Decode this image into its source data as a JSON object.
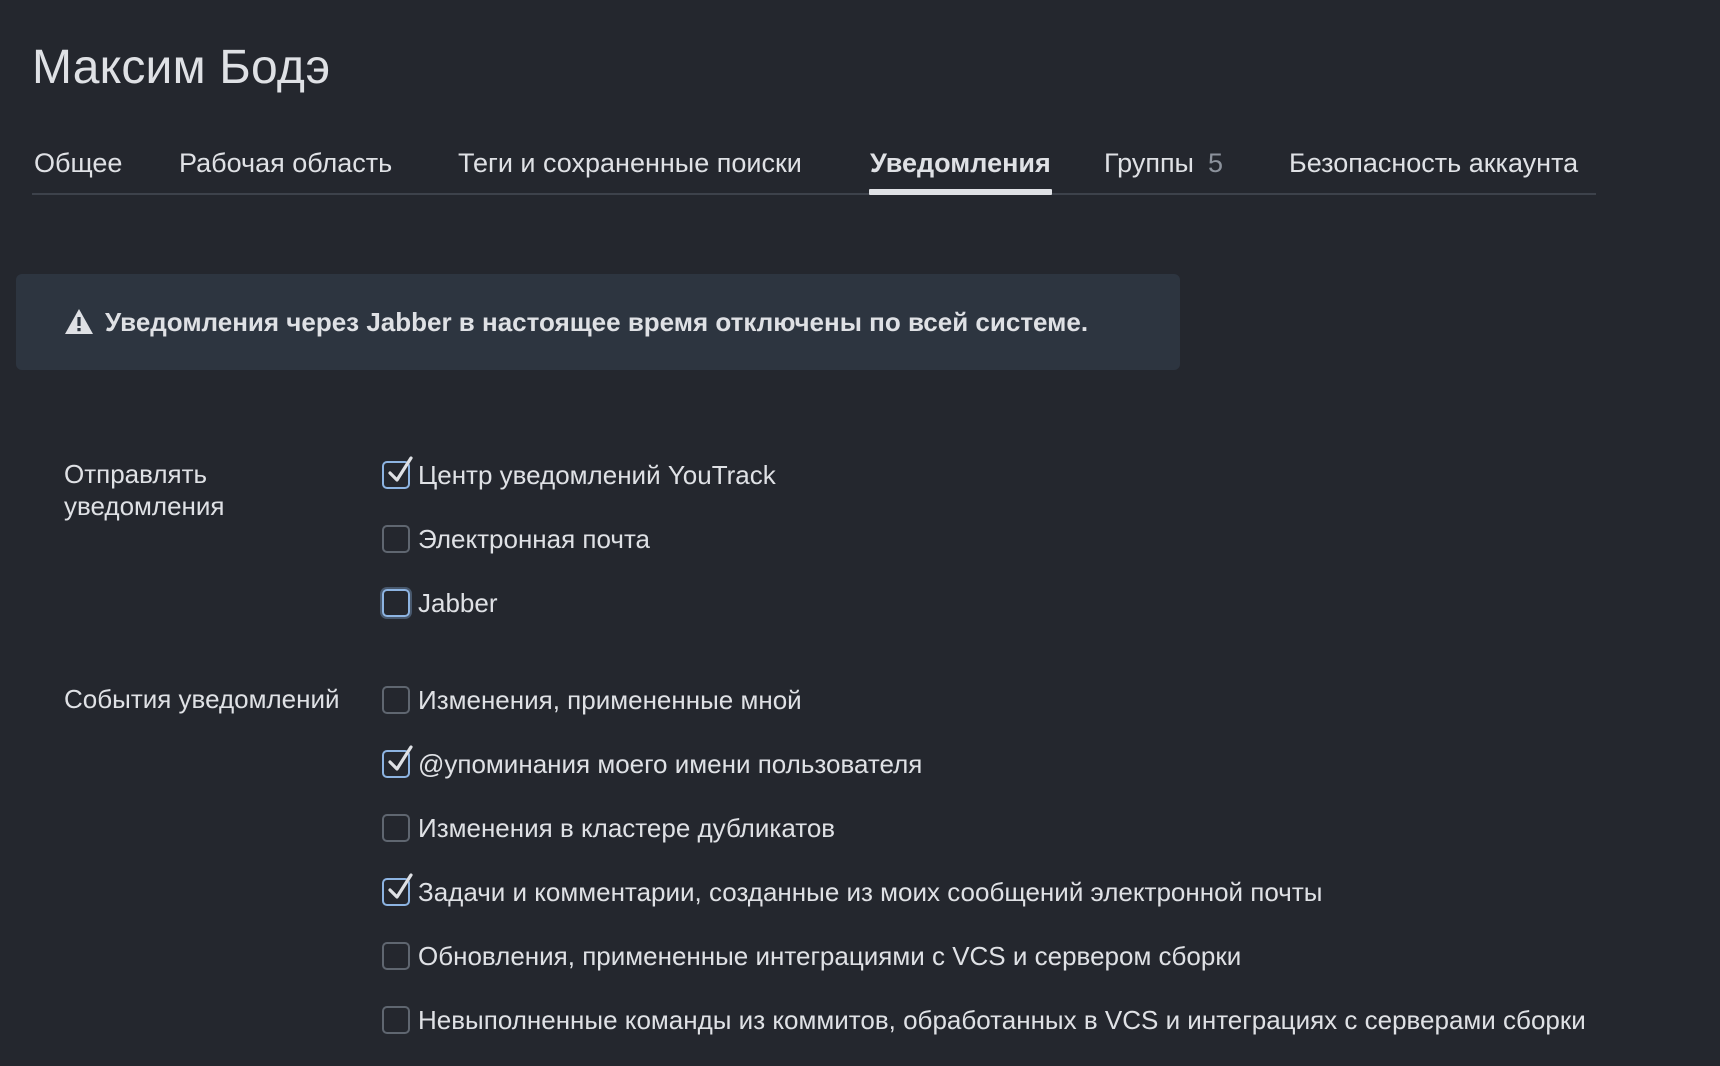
{
  "header": {
    "title": "Максим Бодэ"
  },
  "tabs": [
    {
      "label": "Общее",
      "active": false
    },
    {
      "label": "Рабочая область",
      "active": false
    },
    {
      "label": "Теги и сохраненные поиски",
      "active": false
    },
    {
      "label": "Уведомления",
      "active": true
    },
    {
      "label": "Группы",
      "count": "5",
      "active": false
    },
    {
      "label": "Безопасность аккаунта",
      "active": false
    }
  ],
  "banner": {
    "icon": "warning-icon",
    "text": "Уведомления через Jabber в настоящее время отключены по всей системе."
  },
  "send_notifications": {
    "label": "Отправлять уведомления",
    "label_lines": [
      "Отправлять",
      "уведомления"
    ],
    "options": [
      {
        "label": "Центр уведомлений YouTrack",
        "checked": true
      },
      {
        "label": "Электронная почта",
        "checked": false
      },
      {
        "label": "Jabber",
        "checked": false,
        "focused": true
      }
    ]
  },
  "notification_events": {
    "label": "События уведомлений",
    "options": [
      {
        "label": "Изменения, примененные мной",
        "checked": false
      },
      {
        "label": "@упоминания моего имени пользователя",
        "checked": true
      },
      {
        "label": "Изменения в кластере дубликатов",
        "checked": false
      },
      {
        "label": "Задачи и комментарии, созданные из моих сообщений электронной почты",
        "checked": true
      },
      {
        "label": "Обновления, примененные интеграциями с VCS и сервером сборки",
        "checked": false
      },
      {
        "label": "Невыполненные команды из коммитов, обработанных в VCS и интеграциях с серверами сборки",
        "checked": false
      }
    ]
  },
  "colors": {
    "background": "#24272e",
    "text": "#dfe1e5",
    "banner_background": "#2d3540",
    "checkbox_border": "#5f6670",
    "accent": "#8db4e2",
    "muted": "#8c929c"
  }
}
